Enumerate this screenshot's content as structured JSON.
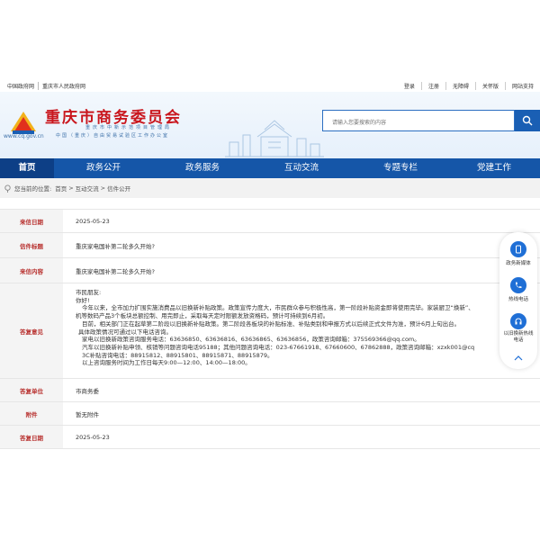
{
  "topbar": {
    "left_links": [
      "中国政府网",
      "重庆市人民政府网"
    ],
    "right_links": [
      "登录",
      "注册",
      "无障碍",
      "关怀版",
      "网站支持"
    ]
  },
  "header": {
    "title": "重庆市商务委员会",
    "subtitle_line1": "重庆市中新示范项目管理局",
    "subtitle_line2": "中国（重庆）自由贸易试验区工作办公室",
    "domain": "www.cq.gov.cn",
    "search_placeholder": "请输入您要搜索的内容"
  },
  "nav": {
    "items": [
      "首页",
      "政务公开",
      "政务服务",
      "互动交流",
      "专题专栏",
      "党建工作"
    ]
  },
  "breadcrumb": {
    "prefix": "您当前的位置:",
    "items": [
      "首页",
      "互动交流",
      "信件公开"
    ],
    "separator": ">"
  },
  "letter": {
    "received_date_label": "来信日期",
    "received_date": "2025-05-23",
    "title_label": "信件标题",
    "title": "重庆家电国补第二轮多久开始?",
    "content_label": "来信内容",
    "content": "重庆家电国补第二轮多久开始?",
    "reply_label": "答复意见",
    "reply_lines": [
      "市民朋友:",
      "你好!",
      "今年以来，全市加力扩围实施消费品以旧换新补贴政策。政策宣传力度大，市民群众参与积极性高，第一阶段补贴资金即将使用完毕。家装厨卫“焕新”、",
      "机等数码产品3个板块总额控制、用完即止，采取每天定时限额发放资格码，预计可持续到6月初。",
      "目前，相关部门正在起草第二阶段以旧换新补贴政策。第二阶段各板块的补贴标准、补贴类别和申报方式以后续正式文件为准，预计6月上旬出台。",
      "具体政策情况可通过以下电话咨询。",
      "家电以旧换新政策咨询服务电话：63636850、63636816、63636865、63636856，政策咨询邮箱：375569366@qq.com。",
      "汽车以旧换新补贴申领、核销等问题咨询电话95188；其他问题咨询电话：023-67661918、67660600、67862888，政策咨询邮箱：xzxk001@cq",
      "3C补贴咨询电话：88915812、88915801、88915871、88915879。",
      "以上咨询服务时间为工作日每天9:00—12:00、14:00—18:00。"
    ],
    "unit_label": "答复单位",
    "unit": "市商务委",
    "attachment_label": "附件",
    "attachment": "暂无附件",
    "reply_date_label": "答复日期",
    "reply_date": "2025-05-23"
  },
  "float_panel": {
    "items": [
      "政务新媒体",
      "热线电话",
      "以旧换新热线电话"
    ]
  },
  "colors": {
    "nav_bg": "#1556a8",
    "nav_active": "#0d3f86",
    "title_red": "#c9161d",
    "label_red": "#b8312f"
  }
}
